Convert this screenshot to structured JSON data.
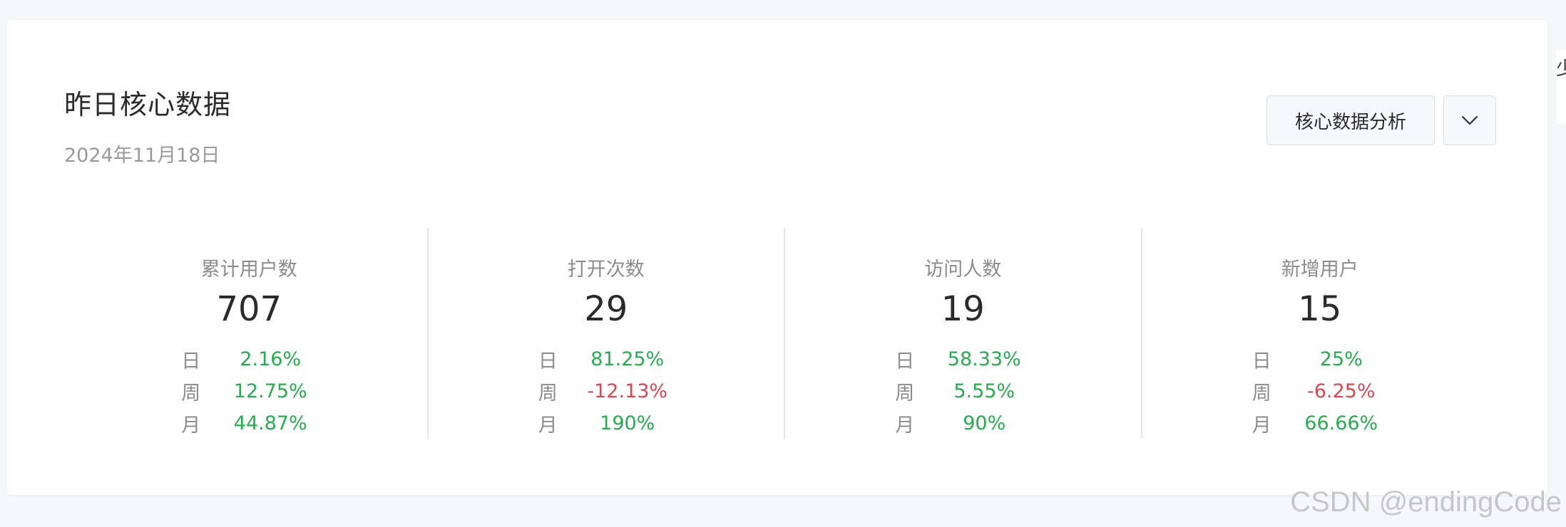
{
  "card": {
    "title": "昨日核心数据",
    "date": "2024年11月18日",
    "analysis_button": "核心数据分析",
    "dropdown_icon": "chevron-down-icon"
  },
  "side_peek_text": "少",
  "colors": {
    "positive": "#21b04b",
    "negative": "#e0454f",
    "muted": "#8c8c8c",
    "text": "#2b2b2b"
  },
  "metrics": [
    {
      "label": "累计用户数",
      "value": "707",
      "rows": [
        {
          "period": "日",
          "change": "2.16%",
          "trend": "up"
        },
        {
          "period": "周",
          "change": "12.75%",
          "trend": "up"
        },
        {
          "period": "月",
          "change": "44.87%",
          "trend": "up"
        }
      ]
    },
    {
      "label": "打开次数",
      "value": "29",
      "rows": [
        {
          "period": "日",
          "change": "81.25%",
          "trend": "up"
        },
        {
          "period": "周",
          "change": "-12.13%",
          "trend": "down"
        },
        {
          "period": "月",
          "change": "190%",
          "trend": "up"
        }
      ]
    },
    {
      "label": "访问人数",
      "value": "19",
      "rows": [
        {
          "period": "日",
          "change": "58.33%",
          "trend": "up"
        },
        {
          "period": "周",
          "change": "5.55%",
          "trend": "up"
        },
        {
          "period": "月",
          "change": "90%",
          "trend": "up"
        }
      ]
    },
    {
      "label": "新增用户",
      "value": "15",
      "rows": [
        {
          "period": "日",
          "change": "25%",
          "trend": "up"
        },
        {
          "period": "周",
          "change": "-6.25%",
          "trend": "down"
        },
        {
          "period": "月",
          "change": "66.66%",
          "trend": "up"
        }
      ]
    }
  ],
  "watermark": "CSDN @endingCode"
}
